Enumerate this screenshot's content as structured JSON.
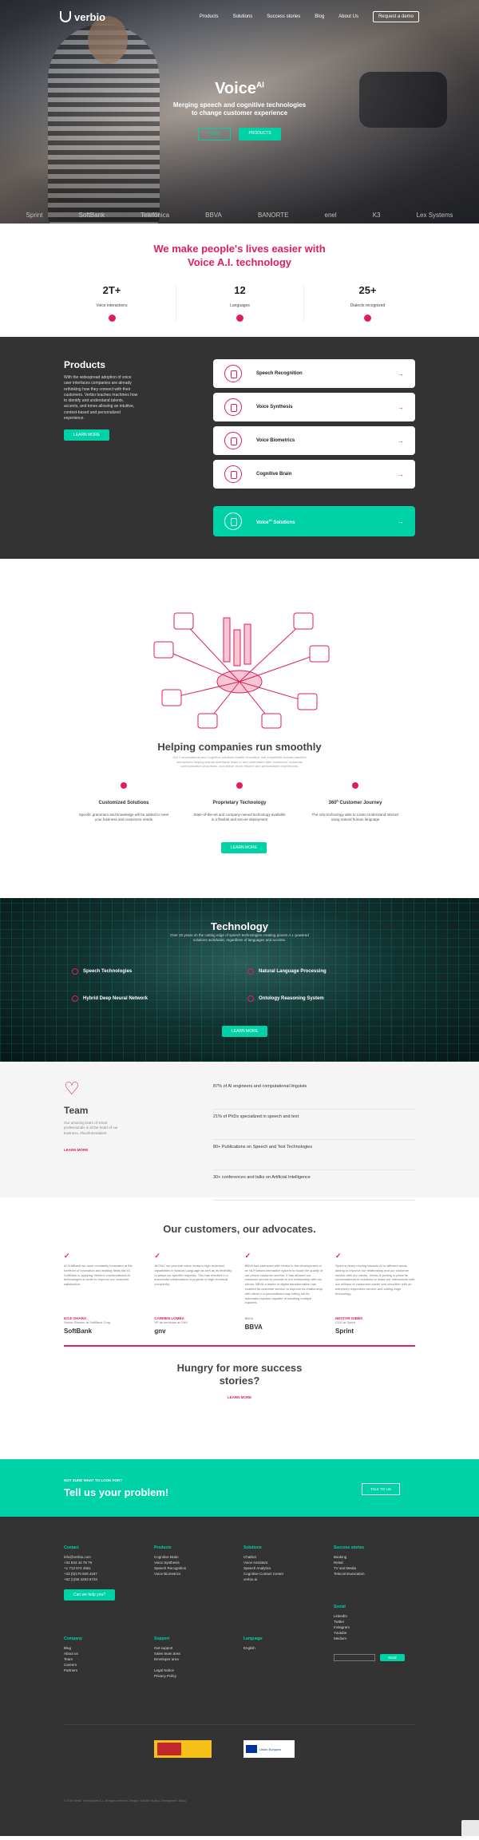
{
  "brand": {
    "name": "verbio"
  },
  "nav": {
    "items": [
      "Products",
      "Solutions",
      "Success stories",
      "Blog",
      "About Us"
    ],
    "request_label": "Request a demo"
  },
  "hero": {
    "title": "Voice",
    "title_sup": "AI",
    "subtitle": "Merging speech and cognitive technologies to change customer experience",
    "btn_demo": "DEMO",
    "btn_products": "PRODUCTS",
    "client_logos": [
      "Sprint",
      "SoftBank",
      "Telefónica",
      "BBVA",
      "BANORTE",
      "enel",
      "K3",
      "Lex Systems"
    ]
  },
  "mission": {
    "headline": "We make people's lives easier with Voice A.I. technology",
    "stats": [
      {
        "value": "2T+",
        "label": "Voice interactions"
      },
      {
        "value": "12",
        "label": "Languages"
      },
      {
        "value": "25+",
        "label": "Dialects recognized"
      }
    ]
  },
  "products": {
    "title": "Products",
    "description": "With the widespread adoption of voice user interfaces companies are already rethinking how they connect with their customers. Verbio teaches machines how to identify and understand talents, accents, and tones allowing an intuitive, context-based and personalized experience.",
    "learn_more": "LEARN MORE",
    "items": [
      "Speech Recognition",
      "Voice Synthesis",
      "Voice Biometrics",
      "Cognitive Brain"
    ],
    "solutions_label": "Voice",
    "solutions_sup": "AI",
    "solutions_suffix": "Solutions"
  },
  "helping": {
    "title": "Helping companies run smoothly",
    "subtitle": "Our Conversational and Cognitive solutions enable innovative and empathetic human-machine interactions helping brands worldwide listen to and understand their customers, automate communication processes, and deliver more efficient and personalized experiences.",
    "pillars": [
      {
        "title": "Customized Solutions",
        "text": "Specific grammars and knowledge will be added to meet your business and customers needs"
      },
      {
        "title": "Proprietary Technology",
        "text": "State-of-the-art and company-owned technology available in a flexible and secure deployment"
      },
      {
        "title": "360º Customer Journey",
        "text": "The only technology able to Listen Understand Interact using natural human language"
      }
    ],
    "learn_more": "LEARN MORE"
  },
  "technology": {
    "title": "Technology",
    "subtitle": "Over 20 years on the cutting edge of speech technologies creating proven A.I.-powered solutions worldwide, regardless of languages and accents.",
    "items": [
      "Speech Technologies",
      "Natural Language Processing",
      "Hybrid Deep Neural Network",
      "Ontology Reasoning System"
    ],
    "learn_more": "LEARN MORE"
  },
  "team": {
    "title": "Team",
    "description": "Our amazing team of smart professionals is at the heart of our business. #lovefuturetalent",
    "learn_more": "LEARN MORE",
    "facts": [
      "87% of AI engineers and computational linguists",
      "21% of PhDs specialized in speech and text",
      "80+ Publications on Speech and Text Technologies",
      "30+ conferences and talks on Artificial Intelligence"
    ]
  },
  "advocates": {
    "title": "Our customers, our advocates.",
    "quotes": [
      {
        "text": "At SoftBank we have constantly innovated at the forefront of innovation and leading fields like AI. SoftBank is applying Verbio's conversational AI technologies in order to improve our customer satisfaction.",
        "name": "KOJI OHARA",
        "role": "Senior Director at SoftBank Corp.",
        "logo": "SoftBank"
      },
      {
        "text": "At GNC we promote value Verbio's high technical capabilities in Natural Language as well as its flexibility to adapt our specific requests. This has resulted in a successful collaboration in projects of high technical complexity.",
        "name": "CARMEN LOMBA",
        "role": "VP de servicios at GNV",
        "logo": "gnv"
      },
      {
        "text": "BBVA has partnered with Verbio in the development of an NLP based interactive system to boost the quality of our phone customer service. It has allowed our customer service to provide to our relationship with our clients. BBVA a leader in digital transformation has enabled its customer service to improve its relationship with client in a personalized way rolling out its automated system capable of handling multiple inquiries.",
        "name": "",
        "role": "BBVA",
        "logo": "BBVA"
      },
      {
        "text": "Sprint is firmly moving towards AI in different areas aiming to improve our relationship and our customer service with our clients. Verbio is putting in place its conversational AI solutions to make our interactions with our millions of customers easier and smoother with an extremely responsive service and cutting-edge technology.",
        "name": "NESTOR GIBBS",
        "role": "CDO at Sprint",
        "logo": "Sprint"
      }
    ]
  },
  "hungry": {
    "title": "Hungry for more success stories?",
    "learn_more": "LEARN MORE"
  },
  "cta": {
    "small": "NOT SURE WHAT TO LOOK FOR?",
    "title": "Tell us your problem!",
    "button": "TALK TO US"
  },
  "footer": {
    "contact": {
      "title": "Contact",
      "items": [
        "info@verbio.com",
        "+34 934 44 79 79",
        "+1 713 574 4561",
        "+33 (0)170 829 4187",
        "+52 (1)55 4293 6733"
      ],
      "button": "Can we help you?"
    },
    "products": {
      "title": "Products",
      "items": [
        "Cognitive Brain",
        "Voice Synthesis",
        "Speech Recognition",
        "Voice Biometrics"
      ]
    },
    "solutions": {
      "title": "Solutions",
      "items": [
        "Chatbot",
        "Voice Assistant",
        "Speech Analytics",
        "Cognitive Contact Center",
        "verbio.ai"
      ]
    },
    "success": {
      "title": "Success stories",
      "items": [
        "Banking",
        "Retail",
        "TV and Media",
        "Telecommunication"
      ]
    },
    "company": {
      "title": "Company",
      "items": [
        "Blog",
        "About us",
        "Team",
        "Careers",
        "Partners"
      ]
    },
    "support": {
      "title": "Support",
      "items": [
        "Get support",
        "Sales team area",
        "Developer area",
        "",
        "Legal Notice",
        "Privacy Policy"
      ]
    },
    "language": {
      "title": "Language",
      "items": [
        "English"
      ]
    },
    "social": {
      "title": "Social",
      "items": [
        "LinkedIn",
        "Twitter",
        "Instagram",
        "Youtube",
        "Medium"
      ]
    },
    "subscribe": "Send",
    "eu_text": "Unión Europea",
    "copyright": "© 2019 Verbio Technologies S.L. All rights reserved. Design: Hola Bic Studio | Development: Tattoo"
  }
}
